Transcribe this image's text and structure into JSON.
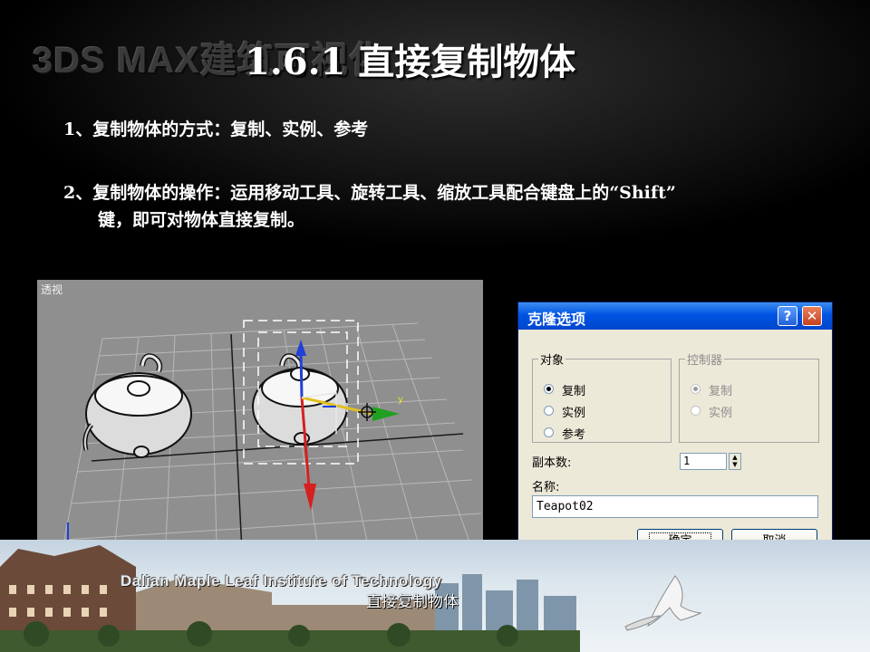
{
  "slide": {
    "watermark": "3DS MAX建筑可视化",
    "title": "1.6.1  直接复制物体",
    "bullets": [
      {
        "line1": "1、复制物体的方式：复制、实例、参考"
      },
      {
        "line1": "2、复制物体的操作：运用移动工具、旋转工具、缩放工具配合键盘上的“Shift”",
        "line2": "键，即可对物体直接复制。"
      }
    ],
    "footer": {
      "institute": "Dalian Maple Leaf Institute of Technology",
      "caption": "直接复制物体"
    }
  },
  "viewport": {
    "label": "透视",
    "gizmo_axis_y": "y",
    "background_color": "#8f8f8f"
  },
  "dialog": {
    "title": "克隆选项",
    "help_button": "?",
    "close_button": "✕",
    "object_group": {
      "legend": "对象",
      "options": [
        "复制",
        "实例",
        "参考"
      ],
      "selected": "复制"
    },
    "controller_group": {
      "legend": "控制器",
      "options": [
        "复制",
        "实例"
      ],
      "selected": "复制",
      "disabled": true
    },
    "copies_label": "副本数:",
    "copies_value": "1",
    "name_label": "名称:",
    "name_value": "Teapot02",
    "ok_button": "确定",
    "cancel_button": "取消",
    "colors": {
      "titlebar": "#0054e3",
      "face": "#ece9d8"
    }
  }
}
